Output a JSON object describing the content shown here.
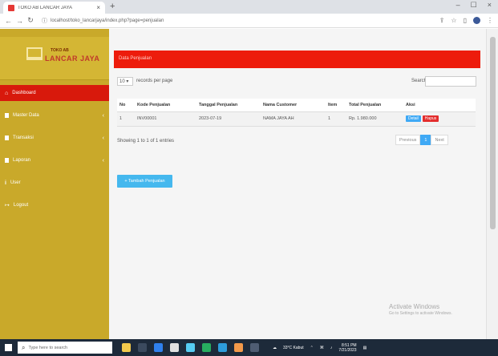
{
  "browser": {
    "tab_title": "TOKO AB LANCAR JAYA",
    "tab_close": "×",
    "new_tab": "+",
    "url": "localhost/toko_lancarjaya/index.php?page=penjualan",
    "win_min": "–",
    "win_max": "☐",
    "win_close": "×"
  },
  "brand": {
    "small": "TOKO AB",
    "big": "LANCAR JAYA"
  },
  "sidebar": {
    "items": [
      {
        "label": "Dashboard"
      },
      {
        "label": "Master Data"
      },
      {
        "label": "Transaksi"
      },
      {
        "label": "Laporan"
      },
      {
        "label": "User"
      },
      {
        "label": "Logout"
      }
    ]
  },
  "page": {
    "title": "Data Penjualan"
  },
  "controls": {
    "length_value": "10",
    "length_text": "records per page",
    "search_label": "Search:"
  },
  "table": {
    "headers": [
      "No",
      "Kode Penjualan",
      "Tanggal Penjualan",
      "Nama Customer",
      "Item",
      "Total Penjualan",
      "Aksi"
    ],
    "rows": [
      {
        "no": "1",
        "kode": "INV00001",
        "tanggal": "2023-07-19",
        "customer": "NAMA JAYA AH",
        "item": "1",
        "total": "Rp. 1.980.000"
      }
    ],
    "btn_detail": "Detail",
    "btn_hapus": "Hapus"
  },
  "info": "Showing 1 to 1 of 1 entries",
  "pager": {
    "previous": "Previous",
    "current": "1",
    "next": "Next"
  },
  "add_button": "+ Tambah Penjualan",
  "watermark": {
    "line1": "Activate Windows",
    "line2": "Go to Settings to activate Windows."
  },
  "taskbar": {
    "search_placeholder": "Type here to search",
    "weather": "33°C Kabut",
    "time": "8:51 PM",
    "date": "7/21/2023"
  }
}
